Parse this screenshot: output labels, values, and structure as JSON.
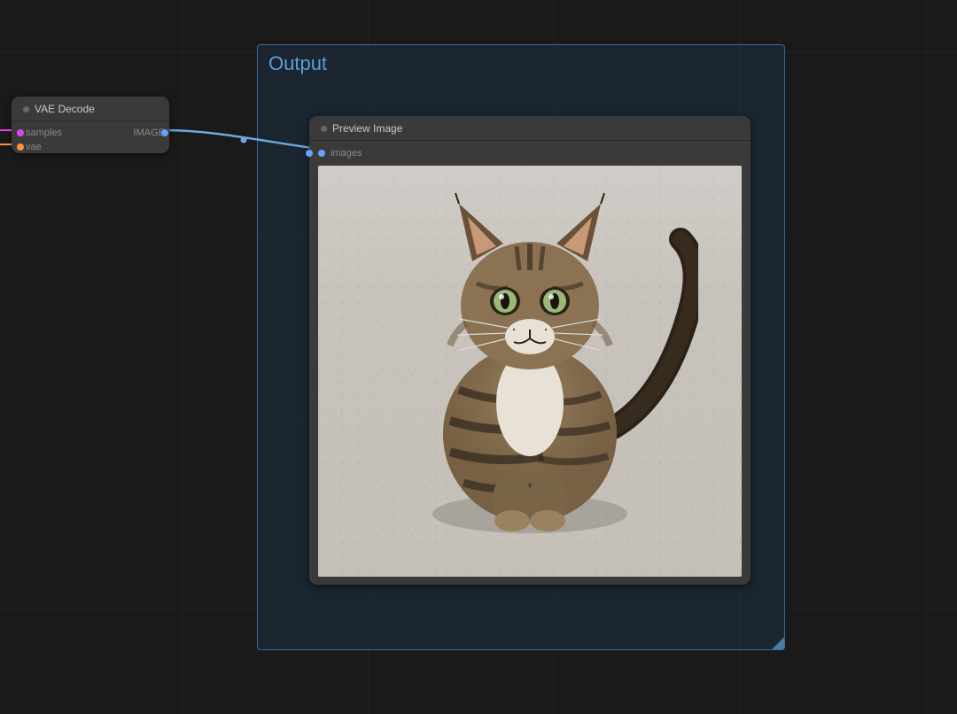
{
  "nodes": {
    "vae_decode": {
      "title": "VAE Decode",
      "inputs": {
        "samples": "samples",
        "vae": "vae"
      },
      "outputs": {
        "image": "IMAGE"
      }
    },
    "preview": {
      "title": "Preview Image",
      "inputs": {
        "images": "images"
      }
    }
  },
  "group": {
    "title": "Output"
  },
  "colors": {
    "port_samples": "#d946ef",
    "port_vae": "#fb923c",
    "port_image": "#60a5fa",
    "connection": "#6aa9e0"
  }
}
